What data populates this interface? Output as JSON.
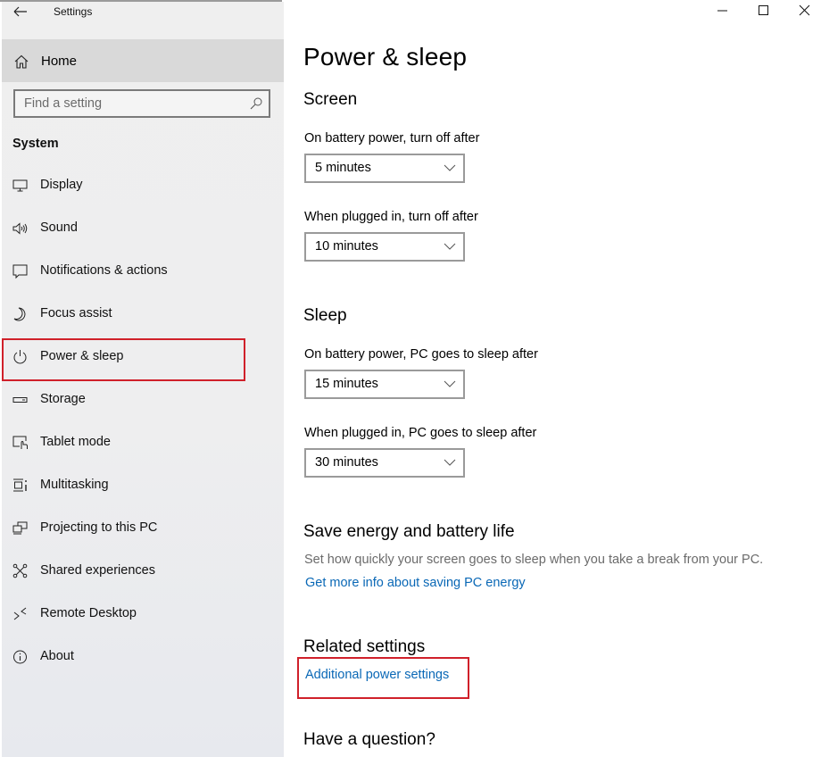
{
  "window": {
    "title": "Settings",
    "controls": [
      "minimize",
      "maximize",
      "close"
    ]
  },
  "sidebar": {
    "home_label": "Home",
    "search": {
      "value": "",
      "placeholder": "Find a setting"
    },
    "section_label": "System",
    "items": [
      {
        "label": "Display",
        "icon": "display-icon"
      },
      {
        "label": "Sound",
        "icon": "sound-icon"
      },
      {
        "label": "Notifications & actions",
        "icon": "notifications-icon"
      },
      {
        "label": "Focus assist",
        "icon": "moon-icon"
      },
      {
        "label": "Power & sleep",
        "icon": "power-icon",
        "selected": true,
        "highlighted": true
      },
      {
        "label": "Storage",
        "icon": "storage-icon"
      },
      {
        "label": "Tablet mode",
        "icon": "tablet-mode-icon"
      },
      {
        "label": "Multitasking",
        "icon": "multitasking-icon"
      },
      {
        "label": "Projecting to this PC",
        "icon": "projecting-icon"
      },
      {
        "label": "Shared experiences",
        "icon": "shared-experiences-icon"
      },
      {
        "label": "Remote Desktop",
        "icon": "remote-desktop-icon"
      },
      {
        "label": "About",
        "icon": "info-icon"
      }
    ]
  },
  "main": {
    "title": "Power & sleep",
    "screen": {
      "heading": "Screen",
      "battery_label": "On battery power, turn off after",
      "battery_value": "5 minutes",
      "plugged_label": "When plugged in, turn off after",
      "plugged_value": "10 minutes"
    },
    "sleep": {
      "heading": "Sleep",
      "battery_label": "On battery power, PC goes to sleep after",
      "battery_value": "15 minutes",
      "plugged_label": "When plugged in, PC goes to sleep after",
      "plugged_value": "30 minutes"
    },
    "save_energy": {
      "heading": "Save energy and battery life",
      "description": "Set how quickly your screen goes to sleep when you take a break from your PC.",
      "link": "Get more info about saving PC energy"
    },
    "related": {
      "heading": "Related settings",
      "link": "Additional power settings",
      "highlighted": true
    },
    "question": {
      "heading": "Have a question?"
    }
  },
  "colors": {
    "highlight": "#d0202a",
    "link": "#0a68b6",
    "sidebar_bg": "#efefef",
    "home_bg": "#d9d9d9"
  }
}
